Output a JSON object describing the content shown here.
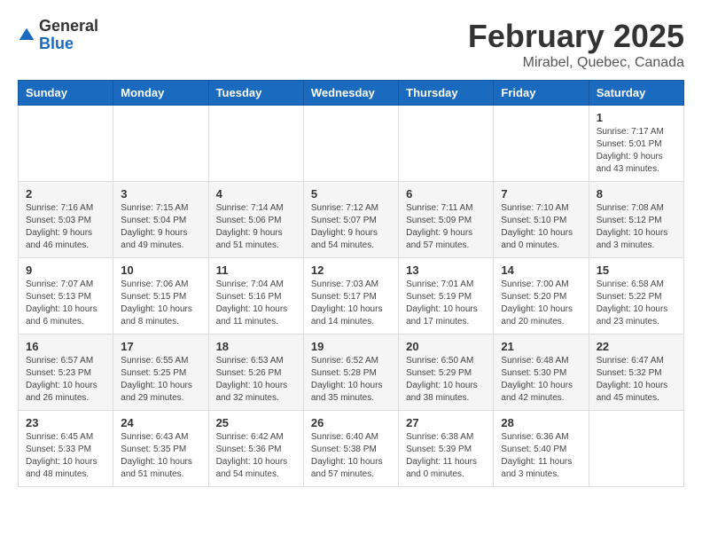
{
  "header": {
    "logo_line1": "General",
    "logo_line2": "Blue",
    "month": "February 2025",
    "location": "Mirabel, Quebec, Canada"
  },
  "weekdays": [
    "Sunday",
    "Monday",
    "Tuesday",
    "Wednesday",
    "Thursday",
    "Friday",
    "Saturday"
  ],
  "weeks": [
    [
      {
        "day": "",
        "info": ""
      },
      {
        "day": "",
        "info": ""
      },
      {
        "day": "",
        "info": ""
      },
      {
        "day": "",
        "info": ""
      },
      {
        "day": "",
        "info": ""
      },
      {
        "day": "",
        "info": ""
      },
      {
        "day": "1",
        "info": "Sunrise: 7:17 AM\nSunset: 5:01 PM\nDaylight: 9 hours and 43 minutes."
      }
    ],
    [
      {
        "day": "2",
        "info": "Sunrise: 7:16 AM\nSunset: 5:03 PM\nDaylight: 9 hours and 46 minutes."
      },
      {
        "day": "3",
        "info": "Sunrise: 7:15 AM\nSunset: 5:04 PM\nDaylight: 9 hours and 49 minutes."
      },
      {
        "day": "4",
        "info": "Sunrise: 7:14 AM\nSunset: 5:06 PM\nDaylight: 9 hours and 51 minutes."
      },
      {
        "day": "5",
        "info": "Sunrise: 7:12 AM\nSunset: 5:07 PM\nDaylight: 9 hours and 54 minutes."
      },
      {
        "day": "6",
        "info": "Sunrise: 7:11 AM\nSunset: 5:09 PM\nDaylight: 9 hours and 57 minutes."
      },
      {
        "day": "7",
        "info": "Sunrise: 7:10 AM\nSunset: 5:10 PM\nDaylight: 10 hours and 0 minutes."
      },
      {
        "day": "8",
        "info": "Sunrise: 7:08 AM\nSunset: 5:12 PM\nDaylight: 10 hours and 3 minutes."
      }
    ],
    [
      {
        "day": "9",
        "info": "Sunrise: 7:07 AM\nSunset: 5:13 PM\nDaylight: 10 hours and 6 minutes."
      },
      {
        "day": "10",
        "info": "Sunrise: 7:06 AM\nSunset: 5:15 PM\nDaylight: 10 hours and 8 minutes."
      },
      {
        "day": "11",
        "info": "Sunrise: 7:04 AM\nSunset: 5:16 PM\nDaylight: 10 hours and 11 minutes."
      },
      {
        "day": "12",
        "info": "Sunrise: 7:03 AM\nSunset: 5:17 PM\nDaylight: 10 hours and 14 minutes."
      },
      {
        "day": "13",
        "info": "Sunrise: 7:01 AM\nSunset: 5:19 PM\nDaylight: 10 hours and 17 minutes."
      },
      {
        "day": "14",
        "info": "Sunrise: 7:00 AM\nSunset: 5:20 PM\nDaylight: 10 hours and 20 minutes."
      },
      {
        "day": "15",
        "info": "Sunrise: 6:58 AM\nSunset: 5:22 PM\nDaylight: 10 hours and 23 minutes."
      }
    ],
    [
      {
        "day": "16",
        "info": "Sunrise: 6:57 AM\nSunset: 5:23 PM\nDaylight: 10 hours and 26 minutes."
      },
      {
        "day": "17",
        "info": "Sunrise: 6:55 AM\nSunset: 5:25 PM\nDaylight: 10 hours and 29 minutes."
      },
      {
        "day": "18",
        "info": "Sunrise: 6:53 AM\nSunset: 5:26 PM\nDaylight: 10 hours and 32 minutes."
      },
      {
        "day": "19",
        "info": "Sunrise: 6:52 AM\nSunset: 5:28 PM\nDaylight: 10 hours and 35 minutes."
      },
      {
        "day": "20",
        "info": "Sunrise: 6:50 AM\nSunset: 5:29 PM\nDaylight: 10 hours and 38 minutes."
      },
      {
        "day": "21",
        "info": "Sunrise: 6:48 AM\nSunset: 5:30 PM\nDaylight: 10 hours and 42 minutes."
      },
      {
        "day": "22",
        "info": "Sunrise: 6:47 AM\nSunset: 5:32 PM\nDaylight: 10 hours and 45 minutes."
      }
    ],
    [
      {
        "day": "23",
        "info": "Sunrise: 6:45 AM\nSunset: 5:33 PM\nDaylight: 10 hours and 48 minutes."
      },
      {
        "day": "24",
        "info": "Sunrise: 6:43 AM\nSunset: 5:35 PM\nDaylight: 10 hours and 51 minutes."
      },
      {
        "day": "25",
        "info": "Sunrise: 6:42 AM\nSunset: 5:36 PM\nDaylight: 10 hours and 54 minutes."
      },
      {
        "day": "26",
        "info": "Sunrise: 6:40 AM\nSunset: 5:38 PM\nDaylight: 10 hours and 57 minutes."
      },
      {
        "day": "27",
        "info": "Sunrise: 6:38 AM\nSunset: 5:39 PM\nDaylight: 11 hours and 0 minutes."
      },
      {
        "day": "28",
        "info": "Sunrise: 6:36 AM\nSunset: 5:40 PM\nDaylight: 11 hours and 3 minutes."
      },
      {
        "day": "",
        "info": ""
      }
    ]
  ]
}
